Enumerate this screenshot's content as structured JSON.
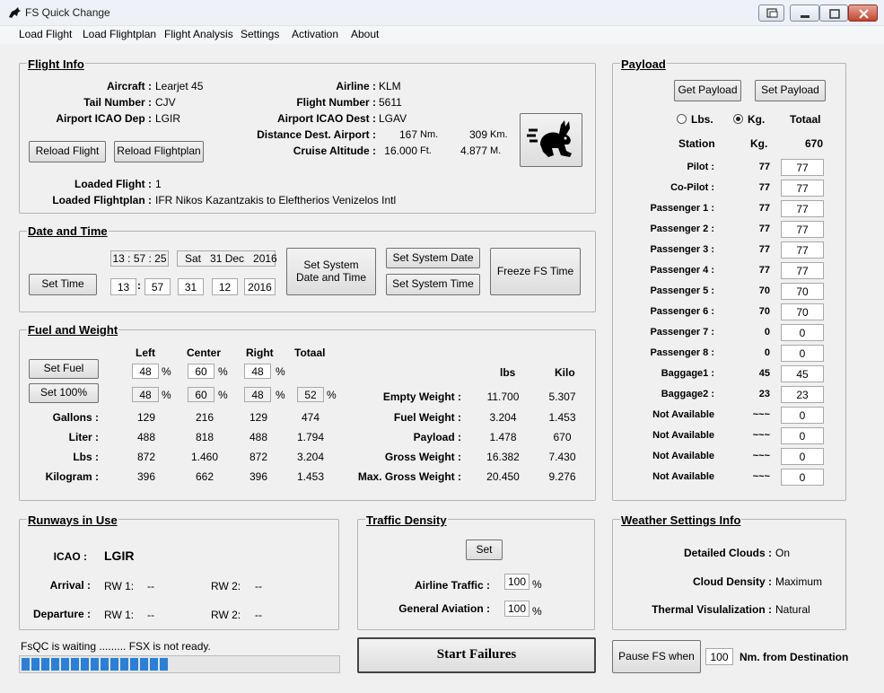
{
  "window": {
    "title": "FS Quick Change"
  },
  "menu": [
    "Load Flight",
    "Load Flightplan",
    "Flight Analysis",
    "Settings",
    "Activation",
    "About"
  ],
  "flight_info": {
    "title": "Flight Info",
    "aircraft_label": "Aircraft :",
    "aircraft": "Learjet 45",
    "tail_label": "Tail Number :",
    "tail": "CJV",
    "dep_label": "Airport ICAO Dep :",
    "dep": "LGIR",
    "airline_label": "Airline :",
    "airline": "KLM",
    "flight_no_label": "Flight Number :",
    "flight_no": "5611",
    "dest_label": "Airport ICAO Dest :",
    "dest": "LGAV",
    "distance_label": "Distance Dest. Airport :",
    "distance_nm": "167",
    "nm_unit": "Nm.",
    "distance_km": "309",
    "km_unit": "Km.",
    "altitude_label": "Cruise Altitude :",
    "altitude_ft": "16.000",
    "ft_unit": "Ft.",
    "altitude_m": "4.877",
    "m_unit": "M.",
    "reload_flight": "Reload Flight",
    "reload_flightplan": "Reload Flightplan",
    "loaded_flight_label": "Loaded Flight :",
    "loaded_flight": "1",
    "loaded_flightplan_label": "Loaded Flightplan :",
    "loaded_flightplan": "IFR Nikos Kazantzakis to Eleftherios Venizelos Intl"
  },
  "date_time": {
    "title": "Date and Time",
    "time_display": "13 : 57 : 25",
    "date_display": "Sat   31 Dec   2016",
    "set_time": "Set Time",
    "hour": "13",
    "colon": ":",
    "minute": "57",
    "day": "31",
    "month": "12",
    "year": "2016",
    "set_system_date_time": "Set System Date and Time",
    "set_system_date": "Set System Date",
    "set_system_time": "Set System Time",
    "freeze_fs_time": "Freeze FS Time"
  },
  "fuel": {
    "title": "Fuel and  Weight",
    "headers": {
      "left": "Left",
      "center": "Center",
      "right": "Right",
      "total": "Totaal"
    },
    "set_fuel": "Set Fuel",
    "set_100": "Set 100%",
    "pct_unit": "%",
    "set_left": "48",
    "set_center": "60",
    "set_right": "48",
    "cur_left": "48",
    "cur_center": "60",
    "cur_right": "48",
    "cur_total": "52",
    "rows": [
      {
        "label": "Gallons :",
        "left": "129",
        "center": "216",
        "right": "129",
        "total": "474"
      },
      {
        "label": "Liter :",
        "left": "488",
        "center": "818",
        "right": "488",
        "total": "1.794"
      },
      {
        "label": "Lbs :",
        "left": "872",
        "center": "1.460",
        "right": "872",
        "total": "3.204"
      },
      {
        "label": "Kilogram :",
        "left": "396",
        "center": "662",
        "right": "396",
        "total": "1.453"
      }
    ],
    "weight_headers": {
      "lbs": "lbs",
      "kilo": "Kilo"
    },
    "weights": [
      {
        "label": "Empty Weight :",
        "lbs": "11.700",
        "kilo": "5.307"
      },
      {
        "label": "Fuel Weight :",
        "lbs": "3.204",
        "kilo": "1.453"
      },
      {
        "label": "Payload :",
        "lbs": "1.478",
        "kilo": "670"
      },
      {
        "label": "Gross Weight :",
        "lbs": "16.382",
        "kilo": "7.430"
      },
      {
        "label": "Max. Gross Weight :",
        "lbs": "20.450",
        "kilo": "9.276"
      }
    ]
  },
  "payload": {
    "title": "Payload",
    "get_payload": "Get Payload",
    "set_payload": "Set Payload",
    "unit_lbs": "Lbs.",
    "unit_kg": "Kg.",
    "total_label": "Totaal",
    "station_header": "Station",
    "kg_header": "Kg.",
    "total_value": "670",
    "stations": [
      {
        "label": "Pilot :",
        "kg": "77",
        "input": "77"
      },
      {
        "label": "Co-Pilot :",
        "kg": "77",
        "input": "77"
      },
      {
        "label": "Passenger 1 :",
        "kg": "77",
        "input": "77"
      },
      {
        "label": "Passenger 2 :",
        "kg": "77",
        "input": "77"
      },
      {
        "label": "Passenger 3 :",
        "kg": "77",
        "input": "77"
      },
      {
        "label": "Passenger 4 :",
        "kg": "77",
        "input": "77"
      },
      {
        "label": "Passenger 5 :",
        "kg": "70",
        "input": "70"
      },
      {
        "label": "Passenger 6 :",
        "kg": "70",
        "input": "70"
      },
      {
        "label": "Passenger 7 :",
        "kg": "0",
        "input": "0"
      },
      {
        "label": "Passenger 8 :",
        "kg": "0",
        "input": "0"
      },
      {
        "label": "Baggage1 :",
        "kg": "45",
        "input": "45"
      },
      {
        "label": "Baggage2 :",
        "kg": "23",
        "input": "23"
      },
      {
        "label": "Not Available",
        "kg": "~~~",
        "input": "0"
      },
      {
        "label": "Not Available",
        "kg": "~~~",
        "input": "0"
      },
      {
        "label": "Not Available",
        "kg": "~~~",
        "input": "0"
      },
      {
        "label": "Not Available",
        "kg": "~~~",
        "input": "0"
      }
    ]
  },
  "runways": {
    "title": "Runways in Use",
    "icao_label": "ICAO :",
    "icao": "LGIR",
    "arrival_label": "Arrival :",
    "departure_label": "Departure :",
    "rw1_label": "RW 1:",
    "rw2_label": "RW 2:",
    "arr_rw1": "--",
    "arr_rw2": "--",
    "dep_rw1": "--",
    "dep_rw2": "--"
  },
  "traffic": {
    "title": "Traffic Density",
    "set": "Set",
    "airline_label": "Airline Traffic :",
    "airline_value": "100",
    "ga_label": "General Aviation :",
    "ga_value": "100",
    "pct_unit": "%"
  },
  "weather": {
    "title": "Weather Settings Info",
    "clouds_label": "Detailed Clouds :",
    "clouds": "On",
    "density_label": "Cloud Density :",
    "density": "Maximum",
    "thermal_label": "Thermal Visulalization :",
    "thermal": "Natural"
  },
  "status": {
    "text": "FsQC is waiting ......... FSX is not ready.",
    "progress_fraction": 0.47
  },
  "start_failures": "Start Failures",
  "pause": {
    "button": "Pause FS when",
    "value": "100",
    "suffix": "Nm. from Destination"
  }
}
